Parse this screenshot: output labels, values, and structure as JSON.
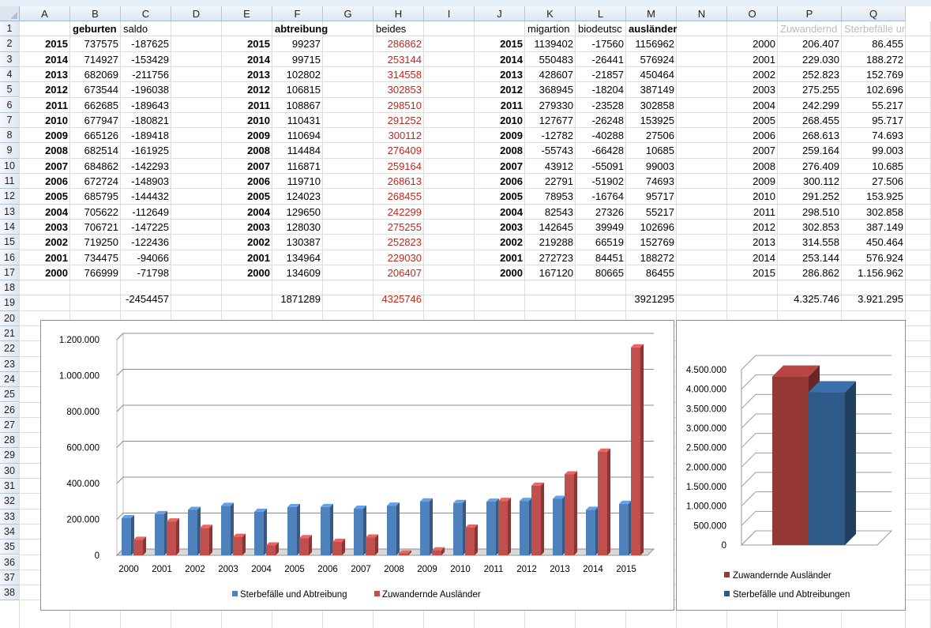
{
  "columns": [
    "A",
    "B",
    "C",
    "D",
    "E",
    "F",
    "G",
    "H",
    "I",
    "J",
    "K",
    "L",
    "M",
    "N",
    "O",
    "P",
    "Q"
  ],
  "rows": [
    "1",
    "2",
    "3",
    "4",
    "5",
    "6",
    "7",
    "8",
    "9",
    "10",
    "11",
    "12",
    "13",
    "14",
    "15",
    "16",
    "17",
    "18",
    "19",
    "20",
    "21",
    "22",
    "23",
    "24",
    "25",
    "26",
    "27",
    "28",
    "29",
    "30",
    "31",
    "32",
    "33",
    "34",
    "35",
    "36",
    "37",
    "38"
  ],
  "headers": {
    "B": "geburten",
    "C": "saldo",
    "F": "abtreibung",
    "H": "beides",
    "K": "migartion",
    "L": "biodeutsc",
    "M": "ausländer",
    "P": "Zuwandernd",
    "Q": "Sterbefälle und A"
  },
  "block1": {
    "years": [
      "2015",
      "2014",
      "2013",
      "2012",
      "2011",
      "2010",
      "2009",
      "2008",
      "2007",
      "2006",
      "2005",
      "2004",
      "2003",
      "2002",
      "2001",
      "2000"
    ],
    "geburten": [
      "737575",
      "714927",
      "682069",
      "673544",
      "662685",
      "677947",
      "665126",
      "682514",
      "684862",
      "672724",
      "685795",
      "705622",
      "706721",
      "719250",
      "734475",
      "766999"
    ],
    "saldo": [
      "-187625",
      "-153429",
      "-211756",
      "-196038",
      "-189643",
      "-180821",
      "-189418",
      "-161925",
      "-142293",
      "-148903",
      "-144432",
      "-112649",
      "-147225",
      "-122436",
      "-94066",
      "-71798"
    ],
    "saldo_total": "-2454457"
  },
  "block2": {
    "years": [
      "2015",
      "2014",
      "2013",
      "2012",
      "2011",
      "2010",
      "2009",
      "2008",
      "2007",
      "2006",
      "2005",
      "2004",
      "2003",
      "2002",
      "2001",
      "2000"
    ],
    "abtreibung": [
      "99237",
      "99715",
      "102802",
      "106815",
      "108867",
      "110431",
      "110694",
      "114484",
      "116871",
      "119710",
      "124023",
      "129650",
      "128030",
      "130387",
      "134964",
      "134609"
    ],
    "beides": [
      "286862",
      "253144",
      "314558",
      "302853",
      "298510",
      "291252",
      "300112",
      "276409",
      "259164",
      "268613",
      "268455",
      "242299",
      "275255",
      "252823",
      "229030",
      "206407"
    ],
    "abtreibung_total": "1871289",
    "beides_total": "4325746"
  },
  "block3": {
    "years": [
      "2015",
      "2014",
      "2013",
      "2012",
      "2011",
      "2010",
      "2009",
      "2008",
      "2007",
      "2006",
      "2005",
      "2004",
      "2003",
      "2002",
      "2001",
      "2000"
    ],
    "migration": [
      "1139402",
      "550483",
      "428607",
      "368945",
      "279330",
      "127677",
      "-12782",
      "-55743",
      "43912",
      "22791",
      "78953",
      "82543",
      "142645",
      "219288",
      "272723",
      "167120"
    ],
    "biodeutsch": [
      "-17560",
      "-26441",
      "-21857",
      "-18204",
      "-23528",
      "-26248",
      "-40288",
      "-66428",
      "-55091",
      "-51902",
      "-16764",
      "27326",
      "39949",
      "66519",
      "84451",
      "80665"
    ],
    "auslaender": [
      "1156962",
      "576924",
      "450464",
      "387149",
      "302858",
      "153925",
      "27506",
      "10685",
      "99003",
      "74693",
      "95717",
      "55217",
      "102696",
      "152769",
      "188272",
      "86455"
    ],
    "auslaender_total": "3921295"
  },
  "block4": {
    "years": [
      "2000",
      "2001",
      "2002",
      "2003",
      "2004",
      "2005",
      "2006",
      "2007",
      "2008",
      "2009",
      "2010",
      "2011",
      "2012",
      "2013",
      "2014",
      "2015"
    ],
    "zuwandernde": [
      "206.407",
      "229.030",
      "252.823",
      "275.255",
      "242.299",
      "268.455",
      "268.613",
      "259.164",
      "276.409",
      "300.112",
      "291.252",
      "298.510",
      "302.853",
      "314.558",
      "253.144",
      "286.862"
    ],
    "sterbefaelle": [
      "86.455",
      "188.272",
      "152.769",
      "102.696",
      "55.217",
      "95.717",
      "74.693",
      "99.003",
      "10.685",
      "27.506",
      "153.925",
      "302.858",
      "387.149",
      "450.464",
      "576.924",
      "1.156.962"
    ],
    "zuwandernde_total": "4.325.746",
    "sterbefaelle_total": "3.921.295"
  },
  "chart_data": [
    {
      "type": "bar",
      "categories": [
        "2000",
        "2001",
        "2002",
        "2003",
        "2004",
        "2005",
        "2006",
        "2007",
        "2008",
        "2009",
        "2010",
        "2011",
        "2012",
        "2013",
        "2014",
        "2015"
      ],
      "series": [
        {
          "name": "Sterbefälle und Abtreibung",
          "color": "#4f81bd",
          "values": [
            206407,
            229030,
            252823,
            275255,
            242299,
            268455,
            268613,
            259164,
            276409,
            300112,
            291252,
            298510,
            302853,
            314558,
            253144,
            286862
          ]
        },
        {
          "name": "Zuwandernde Ausländer",
          "color": "#c0504d",
          "values": [
            86455,
            188272,
            152769,
            102696,
            55217,
            95717,
            74693,
            99003,
            10685,
            27506,
            153925,
            302858,
            387149,
            450464,
            576924,
            1156962
          ]
        }
      ],
      "y_ticks": [
        "0",
        "200.000",
        "400.000",
        "600.000",
        "800.000",
        "1.000.000",
        "1.200.000"
      ],
      "ylim": [
        0,
        1200000
      ],
      "grid": true,
      "legend": "bottom"
    },
    {
      "type": "bar",
      "categories": [
        ""
      ],
      "series": [
        {
          "name": "Zuwandernde Ausländer",
          "color": "#953735",
          "values": [
            4325746
          ]
        },
        {
          "name": "Sterbefälle und Abtreibungen",
          "color": "#2e5a8a",
          "values": [
            3921295
          ]
        }
      ],
      "y_ticks": [
        "0",
        "500.000",
        "1.000.000",
        "1.500.000",
        "2.000.000",
        "2.500.000",
        "3.000.000",
        "3.500.000",
        "4.000.000",
        "4.500.000"
      ],
      "ylim": [
        0,
        4500000
      ],
      "grid": true,
      "legend": "bottom"
    }
  ]
}
